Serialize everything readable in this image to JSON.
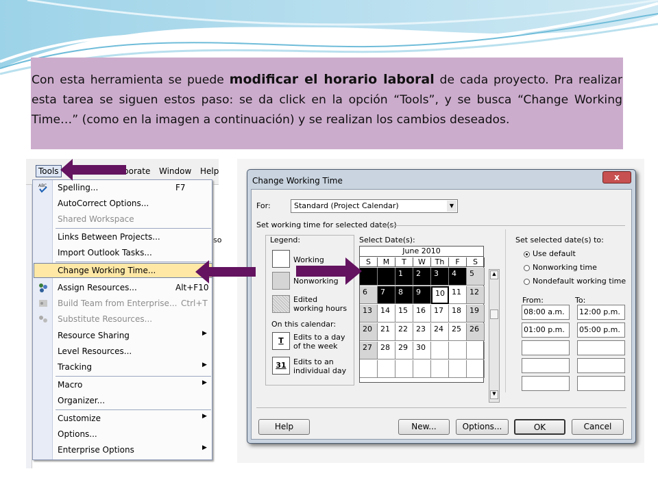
{
  "slide": {
    "paragraph_pre": "Con esta herramienta  se puede ",
    "paragraph_bold": "modificar el horario laboral",
    "paragraph_post": " de cada proyecto. Pra realizar esta tarea se siguen estos paso: se da click en la opción “Tools”, y se busca “Change Working Time…” (como en la imagen a continuación) y se realizan los cambios deseados."
  },
  "menubar": {
    "tools": "Tools",
    "collaborate": "borate",
    "window": "Window",
    "help": "Help"
  },
  "tools_menu": {
    "items": [
      {
        "label": "Spelling...",
        "shortcut": "F7"
      },
      {
        "label": "AutoCorrect Options..."
      },
      {
        "label": "Shared Workspace"
      },
      {
        "label": "Links Between Projects..."
      },
      {
        "label": "Import Outlook Tasks..."
      },
      {
        "label": "Change Working Time..."
      },
      {
        "label": "Assign Resources...",
        "shortcut": "Alt+F10"
      },
      {
        "label": "Build Team from Enterprise...",
        "shortcut": "Ctrl+T"
      },
      {
        "label": "Substitute Resources..."
      },
      {
        "label": "Resource Sharing"
      },
      {
        "label": "Level Resources..."
      },
      {
        "label": "Tracking"
      },
      {
        "label": "Macro"
      },
      {
        "label": "Organizer..."
      },
      {
        "label": "Customize"
      },
      {
        "label": "Options..."
      },
      {
        "label": "Enterprise Options"
      }
    ]
  },
  "side_texts": {
    "so": "so"
  },
  "dialog": {
    "title": "Change Working Time",
    "close": "x",
    "for_label": "For:",
    "for_value": "Standard (Project Calendar)",
    "set_working_time": "Set working time for selected date(s)",
    "legend_label": "Legend:",
    "legend_working": "Working",
    "legend_nonworking": "Nonworking",
    "legend_edited": "Edited working hours",
    "on_this_calendar": "On this calendar:",
    "legend_day_week": "Edits to a day of the week",
    "legend_individual": "Edits to an individual day",
    "legend_t": "T",
    "legend_31": "31",
    "select_dates": "Select Date(s):",
    "month": "June 2010",
    "days_of_week": [
      "S",
      "M",
      "T",
      "W",
      "Th",
      "F",
      "S"
    ],
    "calendar_days": [
      "",
      "",
      "1",
      "2",
      "3",
      "4",
      "5",
      "6",
      "7",
      "8",
      "9",
      "10",
      "11",
      "12",
      "13",
      "14",
      "15",
      "16",
      "17",
      "18",
      "19",
      "20",
      "21",
      "22",
      "23",
      "24",
      "25",
      "26",
      "27",
      "28",
      "29",
      "30",
      "",
      "",
      "",
      "",
      "",
      "",
      "",
      "",
      "",
      ""
    ],
    "set_selected": "Set selected date(s) to:",
    "use_default": "Use default",
    "nonworking_time": "Nonworking time",
    "nondefault_time": "Nondefault working time",
    "from_label": "From:",
    "to_label": "To:",
    "from_values": [
      "08:00 a.m.",
      "01:00 p.m.",
      "",
      "",
      ""
    ],
    "to_values": [
      "12:00 p.m.",
      "05:00 p.m.",
      "",
      "",
      ""
    ],
    "buttons": {
      "help": "Help",
      "new": "New...",
      "options": "Options...",
      "ok": "OK",
      "cancel": "Cancel"
    }
  },
  "colors": {
    "arrow": "#63135f",
    "textbox": "#ccaccd"
  }
}
